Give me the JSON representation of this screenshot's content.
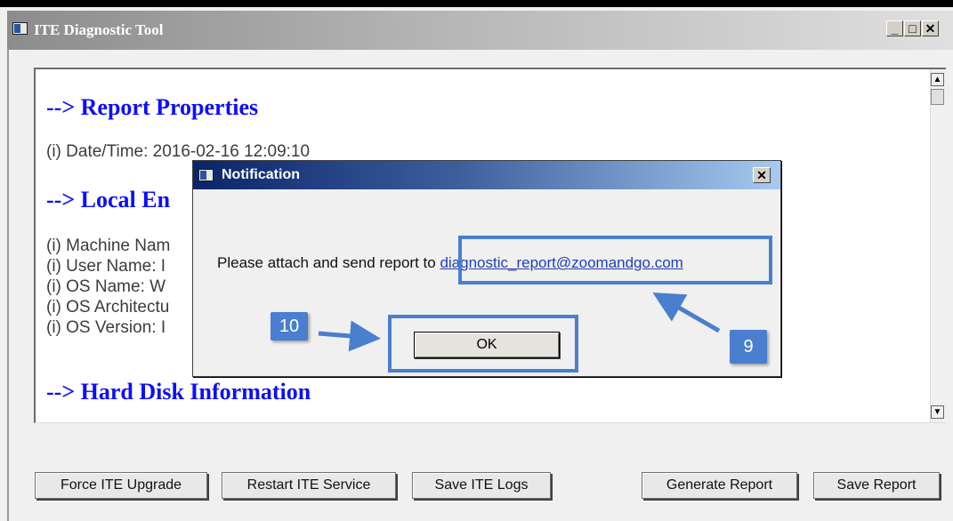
{
  "window": {
    "title": "ITE Diagnostic Tool",
    "controls": {
      "minimize": "_",
      "maximize": "□",
      "close": "✕"
    }
  },
  "report": {
    "heading_properties": "--> Report Properties",
    "datetime_line": "(i) Date/Time: 2016-02-16 12:09:10",
    "heading_local": "--> Local En",
    "lines": [
      "(i) Machine Nam",
      "(i) User Name: I",
      "(i) OS Name: W",
      "(i) OS Architectu",
      "(i) OS Version: I"
    ],
    "heading_disk": "--> Hard Disk Information"
  },
  "buttons": {
    "force_upgrade": "Force ITE Upgrade",
    "restart_service": "Restart ITE Service",
    "save_logs": "Save ITE Logs",
    "generate_report": "Generate Report",
    "save_report": "Save Report"
  },
  "dialog": {
    "title": "Notification",
    "close": "✕",
    "message_prefix": "Please attach and send report to ",
    "email": "diagnostic_report@zoomandgo.com",
    "ok_label": "OK"
  },
  "callouts": {
    "ok_step": "10",
    "email_step": "9"
  },
  "colors": {
    "accent_blue": "#4a7fcf",
    "heading_blue": "#0d0dff",
    "dialog_title": "#0a246a"
  }
}
